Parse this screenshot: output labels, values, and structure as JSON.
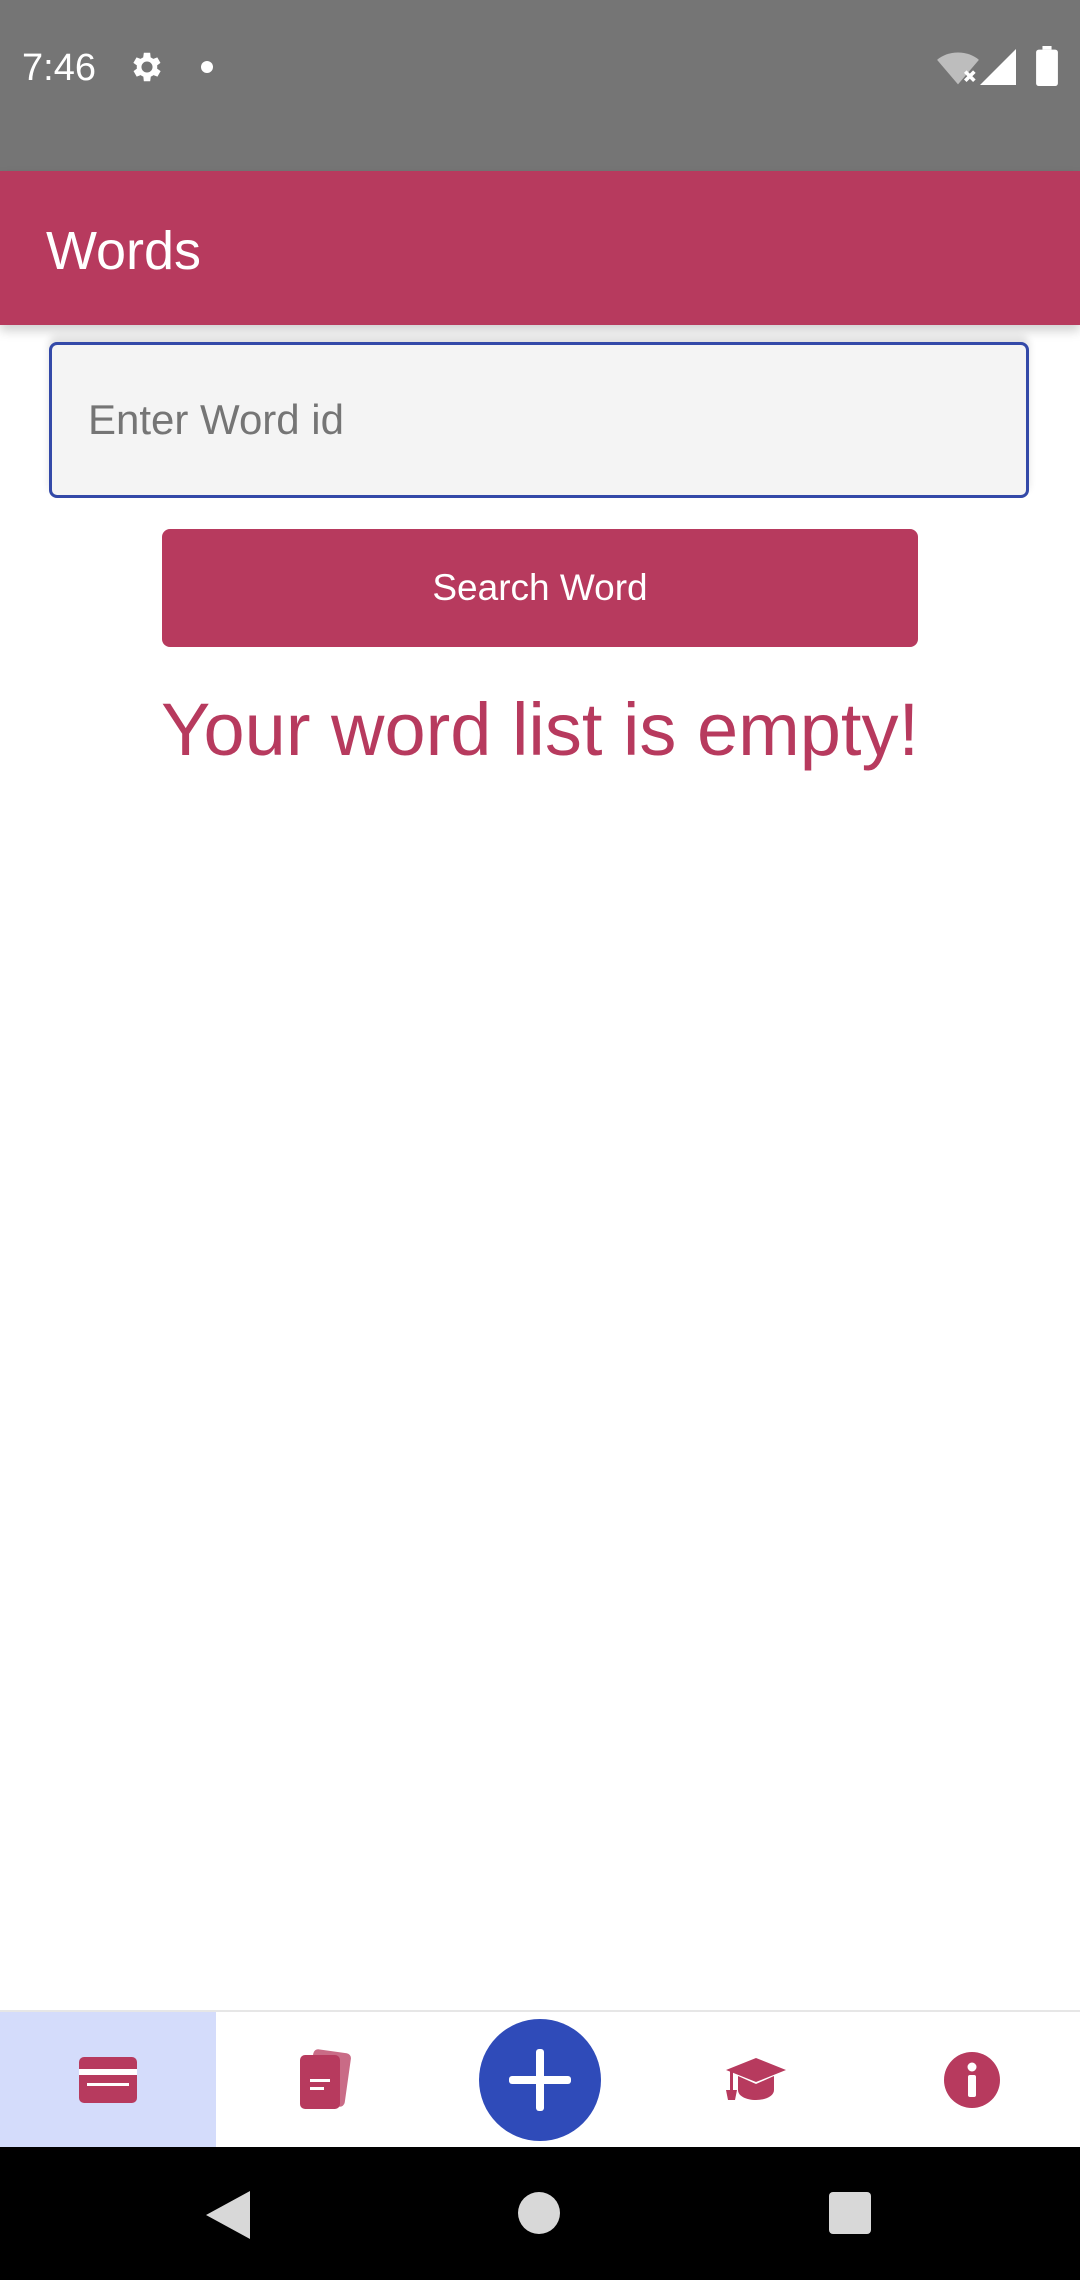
{
  "status_bar": {
    "time": "7:46",
    "icons": [
      "gear-icon",
      "notification-dot-icon",
      "wifi-off-icon",
      "signal-icon",
      "battery-icon"
    ]
  },
  "app_bar": {
    "title": "Words"
  },
  "search": {
    "placeholder": "Enter Word id",
    "value": "",
    "button_label": "Search Word"
  },
  "main": {
    "empty_message": "Your word list is empty!"
  },
  "bottom_nav": {
    "items": [
      {
        "name": "words",
        "icon": "card-icon",
        "active": true
      },
      {
        "name": "cards",
        "icon": "stacked-cards-icon",
        "active": false
      },
      {
        "name": "add",
        "icon": "plus-icon",
        "active": false
      },
      {
        "name": "learn",
        "icon": "graduation-cap-icon",
        "active": false
      },
      {
        "name": "info",
        "icon": "info-icon",
        "active": false
      }
    ]
  },
  "system_nav": {
    "buttons": [
      "back-icon",
      "home-icon",
      "recents-icon"
    ]
  },
  "colors": {
    "primary": "#b73a5e",
    "accent": "#2f4bb9",
    "status_bar": "#757575",
    "nav_active_bg": "#d4dcfb"
  }
}
